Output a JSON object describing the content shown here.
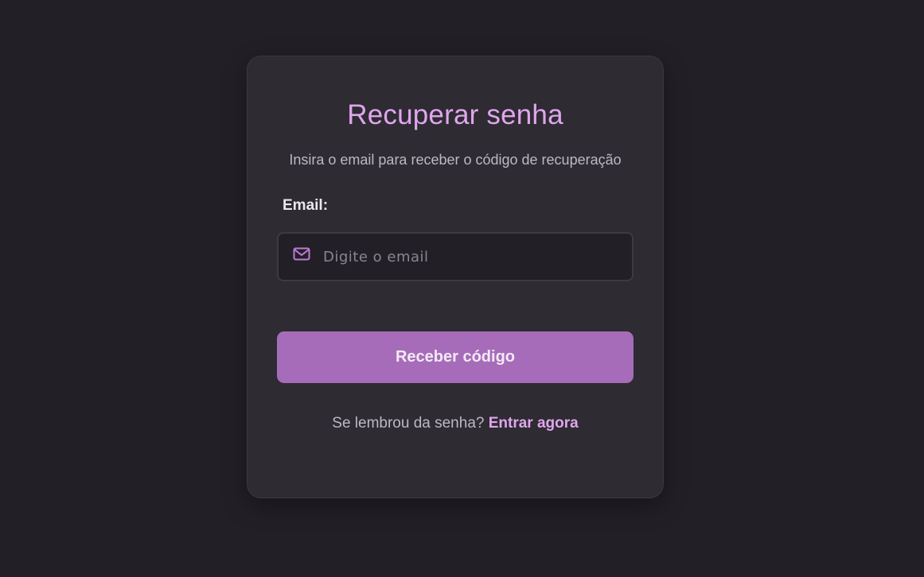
{
  "form": {
    "title": "Recuperar senha",
    "subtitle": "Insira o email para receber o código de recuperação",
    "email_label": "Email:",
    "email_placeholder": "Digite o email",
    "email_value": "",
    "submit_label": "Receber código",
    "footer_text": "Se lembrou da senha?",
    "footer_link": "Entrar agora",
    "mail_icon": "mail-icon"
  },
  "colors": {
    "background": "#222026",
    "card": "#2e2b33",
    "accent": "#e0a6ec",
    "button": "#a66cb9"
  }
}
